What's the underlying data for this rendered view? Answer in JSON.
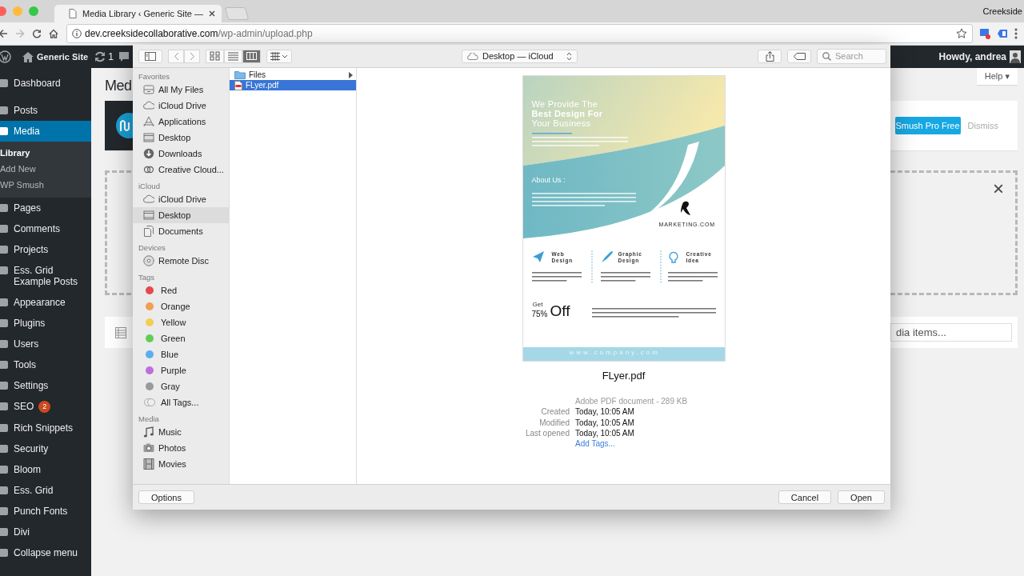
{
  "browser": {
    "window_controls": [
      {
        "kind": "close"
      },
      {
        "kind": "minimize"
      },
      {
        "kind": "zoom"
      }
    ],
    "tabs": [
      {
        "title": "Media Library ‹ Generic Site —",
        "selected": true
      }
    ],
    "profile": "Creekside",
    "address": {
      "host": "dev.creeksidecollaborative.com",
      "path": "/wp-admin/upload.php"
    }
  },
  "admin_bar": {
    "site": "Generic Site",
    "updates": "1",
    "greeting": "Howdy, andrea"
  },
  "menu": [
    {
      "label": "Dashboard",
      "selected": false
    },
    {
      "label": "Posts",
      "selected": false
    },
    {
      "label": "Media",
      "selected": true,
      "children": [
        {
          "label": "Library",
          "selected": true
        },
        {
          "label": "Add New",
          "selected": false
        },
        {
          "label": "WP Smush",
          "selected": false
        }
      ]
    },
    {
      "label": "Pages",
      "selected": false
    },
    {
      "label": "Comments",
      "selected": false
    },
    {
      "label": "Projects",
      "selected": false
    },
    {
      "label": "Ess. Grid Example Posts",
      "selected": false
    },
    {
      "label": "Appearance",
      "selected": false
    },
    {
      "label": "Plugins",
      "selected": false
    },
    {
      "label": "Users",
      "selected": false
    },
    {
      "label": "Tools",
      "selected": false
    },
    {
      "label": "Settings",
      "selected": false
    },
    {
      "label": "SEO",
      "selected": false,
      "badge": "2"
    },
    {
      "label": "Rich Snippets",
      "selected": false
    },
    {
      "label": "Security",
      "selected": false
    },
    {
      "label": "Bloom",
      "selected": false
    },
    {
      "label": "Ess. Grid",
      "selected": false
    },
    {
      "label": "Punch Fonts",
      "selected": false
    },
    {
      "label": "Divi",
      "selected": false
    },
    {
      "label": "Collapse menu",
      "selected": false
    }
  ],
  "page": {
    "title": "Med",
    "help": "Help ▾",
    "notice": {
      "button": "Smush Pro Free",
      "dismiss": "Dismiss"
    },
    "close": "×",
    "search_placeholder": "dia items..."
  },
  "dialog": {
    "toolbar": {
      "views": [
        {
          "kind": "icon",
          "selected": false
        },
        {
          "kind": "list",
          "selected": false
        },
        {
          "kind": "column",
          "selected": true
        }
      ],
      "location": "Desktop — iCloud",
      "search_placeholder": "Search"
    },
    "sidebar": [
      {
        "title": "Favorites",
        "items": [
          {
            "label": "All My Files",
            "kind": "place",
            "selected": false
          },
          {
            "label": "iCloud Drive",
            "kind": "place",
            "selected": false
          },
          {
            "label": "Applications",
            "kind": "place",
            "selected": false
          },
          {
            "label": "Desktop",
            "kind": "place",
            "selected": false
          },
          {
            "label": "Downloads",
            "kind": "place",
            "selected": false
          },
          {
            "label": "Creative Cloud...",
            "kind": "place",
            "selected": false
          }
        ]
      },
      {
        "title": "iCloud",
        "items": [
          {
            "label": "iCloud Drive",
            "kind": "place",
            "selected": false
          },
          {
            "label": "Desktop",
            "kind": "place",
            "selected": true
          },
          {
            "label": "Documents",
            "kind": "place",
            "selected": false
          }
        ]
      },
      {
        "title": "Devices",
        "items": [
          {
            "label": "Remote Disc",
            "kind": "place",
            "selected": false
          }
        ]
      },
      {
        "title": "Tags",
        "items": [
          {
            "label": "Red",
            "kind": "tag",
            "color": "#e5484d",
            "selected": false
          },
          {
            "label": "Orange",
            "kind": "tag",
            "color": "#f0a050",
            "selected": false
          },
          {
            "label": "Yellow",
            "kind": "tag",
            "color": "#f0d050",
            "selected": false
          },
          {
            "label": "Green",
            "kind": "tag",
            "color": "#62cd55",
            "selected": false
          },
          {
            "label": "Blue",
            "kind": "tag",
            "color": "#5aaef0",
            "selected": false
          },
          {
            "label": "Purple",
            "kind": "tag",
            "color": "#bf6fdc",
            "selected": false
          },
          {
            "label": "Gray",
            "kind": "tag",
            "color": "#9a9a9a",
            "selected": false
          },
          {
            "label": "All Tags...",
            "kind": "all-tags",
            "selected": false
          }
        ]
      },
      {
        "title": "Media",
        "items": [
          {
            "label": "Music",
            "kind": "place",
            "selected": false
          },
          {
            "label": "Photos",
            "kind": "place",
            "selected": false
          },
          {
            "label": "Movies",
            "kind": "place",
            "selected": false
          }
        ]
      }
    ],
    "column": [
      {
        "name": "Files",
        "kind": "folder",
        "selected": false
      },
      {
        "name": "FLyer.pdf",
        "kind": "pdf",
        "selected": true
      }
    ],
    "preview": {
      "flyer": {
        "headline": [
          {
            "text": "We Provide The",
            "bold": false
          },
          {
            "text": "Best Design For",
            "bold": true
          },
          {
            "text": "Your Business",
            "bold": false
          }
        ],
        "about": "About Us :",
        "brand": "MARKETING.COM",
        "services": [
          "Web Design",
          "Graphic Design",
          "Creative Idea"
        ],
        "offer_prefix": "Get",
        "offer_value": "75%",
        "offer_word": "Off",
        "footer": "www.company.com"
      },
      "filename": "FLyer.pdf",
      "summary": "Adobe PDF document - 289 KB",
      "details": [
        {
          "label": "Created",
          "value": "Today, 10:05 AM"
        },
        {
          "label": "Modified",
          "value": "Today, 10:05 AM"
        },
        {
          "label": "Last opened",
          "value": "Today, 10:05 AM"
        }
      ],
      "add_tags": "Add Tags..."
    },
    "buttons": {
      "options": "Options",
      "cancel": "Cancel",
      "open": "Open"
    }
  }
}
